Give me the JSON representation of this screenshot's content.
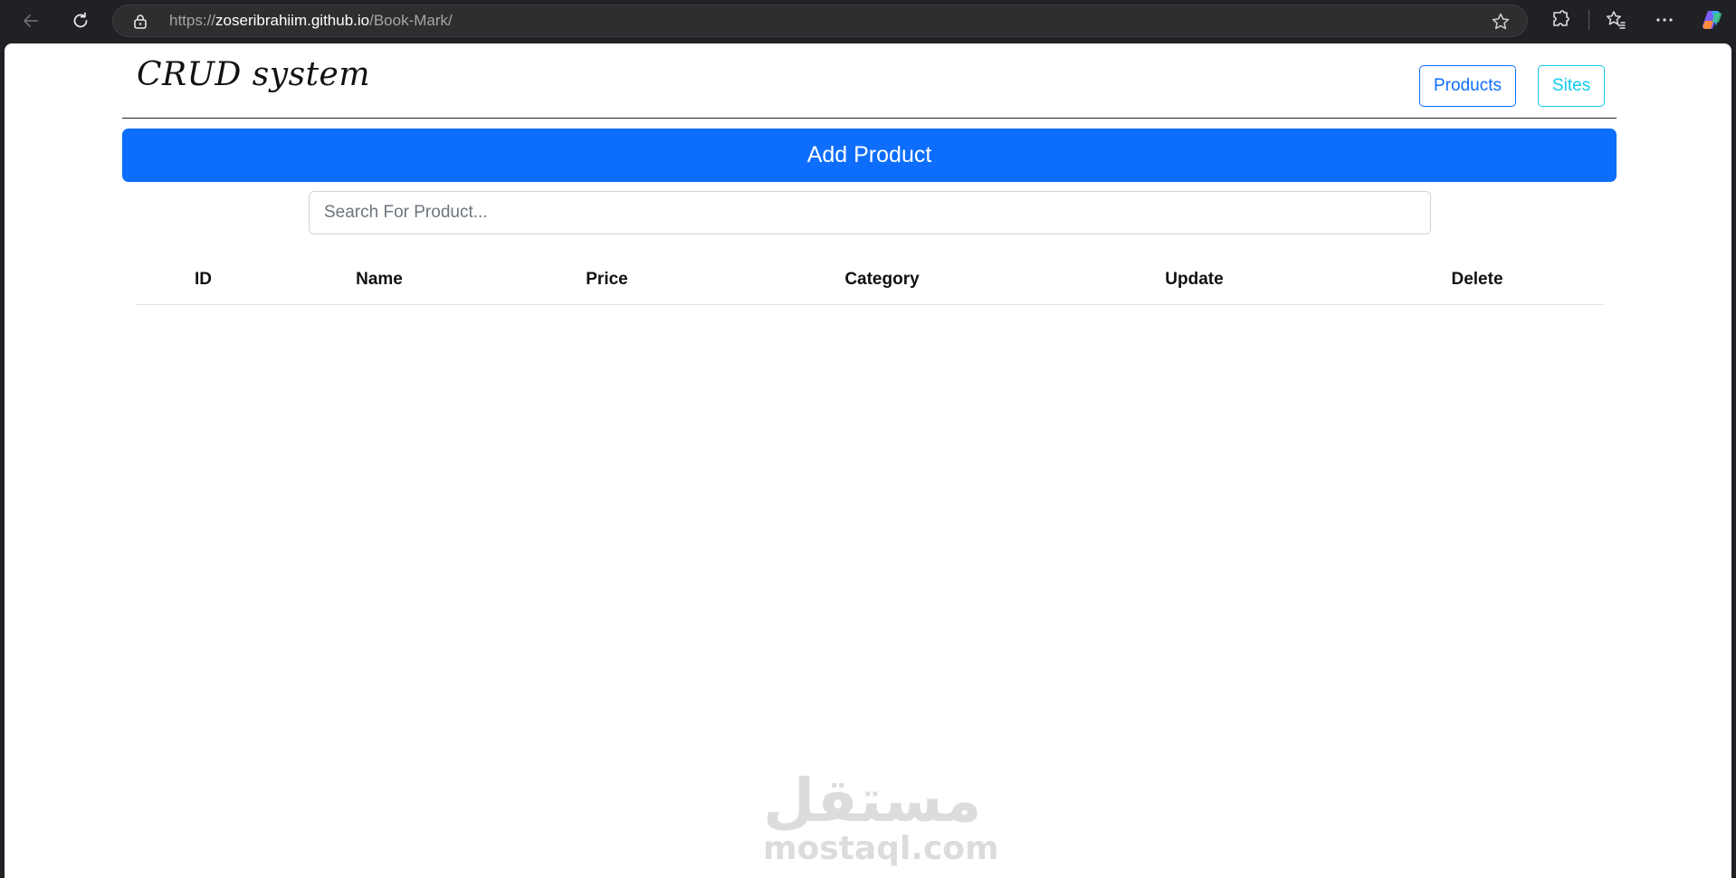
{
  "browser": {
    "url_scheme": "https://",
    "url_host": "zoseribrahiim.github.io",
    "url_path": "/Book-Mark/",
    "icons": [
      "back-arrow-icon",
      "reload-icon",
      "lock-icon",
      "star-icon",
      "extensions-icon",
      "favorites-icon",
      "more-icon",
      "copilot-icon"
    ]
  },
  "header": {
    "brand": "CRUD system",
    "nav": {
      "products_label": "Products",
      "sites_label": "Sites"
    }
  },
  "main": {
    "add_button_label": "Add Product",
    "search": {
      "placeholder": "Search For Product...",
      "value": ""
    },
    "table": {
      "columns": {
        "id": "ID",
        "name": "Name",
        "price": "Price",
        "category": "Category",
        "update": "Update",
        "delete": "Delete"
      },
      "rows": []
    }
  },
  "watermark": {
    "arabic": "مستقل",
    "latin": "mostaql.com"
  },
  "colors": {
    "primary": "#0d6efd",
    "info": "#0dcaf0",
    "browser_chrome": "#202124"
  }
}
